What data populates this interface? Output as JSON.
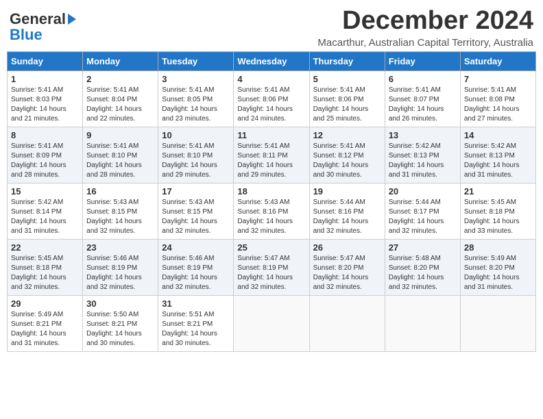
{
  "header": {
    "logo_general": "General",
    "logo_blue": "Blue",
    "month_title": "December 2024",
    "subtitle": "Macarthur, Australian Capital Territory, Australia"
  },
  "days_of_week": [
    "Sunday",
    "Monday",
    "Tuesday",
    "Wednesday",
    "Thursday",
    "Friday",
    "Saturday"
  ],
  "weeks": [
    [
      {
        "day": "1",
        "rise": "5:41 AM",
        "set": "8:03 PM",
        "daylight": "14 hours and 21 minutes"
      },
      {
        "day": "2",
        "rise": "5:41 AM",
        "set": "8:04 PM",
        "daylight": "14 hours and 22 minutes"
      },
      {
        "day": "3",
        "rise": "5:41 AM",
        "set": "8:05 PM",
        "daylight": "14 hours and 23 minutes"
      },
      {
        "day": "4",
        "rise": "5:41 AM",
        "set": "8:06 PM",
        "daylight": "14 hours and 24 minutes"
      },
      {
        "day": "5",
        "rise": "5:41 AM",
        "set": "8:06 PM",
        "daylight": "14 hours and 25 minutes"
      },
      {
        "day": "6",
        "rise": "5:41 AM",
        "set": "8:07 PM",
        "daylight": "14 hours and 26 minutes"
      },
      {
        "day": "7",
        "rise": "5:41 AM",
        "set": "8:08 PM",
        "daylight": "14 hours and 27 minutes"
      }
    ],
    [
      {
        "day": "8",
        "rise": "5:41 AM",
        "set": "8:09 PM",
        "daylight": "14 hours and 28 minutes"
      },
      {
        "day": "9",
        "rise": "5:41 AM",
        "set": "8:10 PM",
        "daylight": "14 hours and 28 minutes"
      },
      {
        "day": "10",
        "rise": "5:41 AM",
        "set": "8:10 PM",
        "daylight": "14 hours and 29 minutes"
      },
      {
        "day": "11",
        "rise": "5:41 AM",
        "set": "8:11 PM",
        "daylight": "14 hours and 29 minutes"
      },
      {
        "day": "12",
        "rise": "5:41 AM",
        "set": "8:12 PM",
        "daylight": "14 hours and 30 minutes"
      },
      {
        "day": "13",
        "rise": "5:42 AM",
        "set": "8:13 PM",
        "daylight": "14 hours and 31 minutes"
      },
      {
        "day": "14",
        "rise": "5:42 AM",
        "set": "8:13 PM",
        "daylight": "14 hours and 31 minutes"
      }
    ],
    [
      {
        "day": "15",
        "rise": "5:42 AM",
        "set": "8:14 PM",
        "daylight": "14 hours and 31 minutes"
      },
      {
        "day": "16",
        "rise": "5:43 AM",
        "set": "8:15 PM",
        "daylight": "14 hours and 32 minutes"
      },
      {
        "day": "17",
        "rise": "5:43 AM",
        "set": "8:15 PM",
        "daylight": "14 hours and 32 minutes"
      },
      {
        "day": "18",
        "rise": "5:43 AM",
        "set": "8:16 PM",
        "daylight": "14 hours and 32 minutes"
      },
      {
        "day": "19",
        "rise": "5:44 AM",
        "set": "8:16 PM",
        "daylight": "14 hours and 32 minutes"
      },
      {
        "day": "20",
        "rise": "5:44 AM",
        "set": "8:17 PM",
        "daylight": "14 hours and 32 minutes"
      },
      {
        "day": "21",
        "rise": "5:45 AM",
        "set": "8:18 PM",
        "daylight": "14 hours and 33 minutes"
      }
    ],
    [
      {
        "day": "22",
        "rise": "5:45 AM",
        "set": "8:18 PM",
        "daylight": "14 hours and 32 minutes"
      },
      {
        "day": "23",
        "rise": "5:46 AM",
        "set": "8:19 PM",
        "daylight": "14 hours and 32 minutes"
      },
      {
        "day": "24",
        "rise": "5:46 AM",
        "set": "8:19 PM",
        "daylight": "14 hours and 32 minutes"
      },
      {
        "day": "25",
        "rise": "5:47 AM",
        "set": "8:19 PM",
        "daylight": "14 hours and 32 minutes"
      },
      {
        "day": "26",
        "rise": "5:47 AM",
        "set": "8:20 PM",
        "daylight": "14 hours and 32 minutes"
      },
      {
        "day": "27",
        "rise": "5:48 AM",
        "set": "8:20 PM",
        "daylight": "14 hours and 32 minutes"
      },
      {
        "day": "28",
        "rise": "5:49 AM",
        "set": "8:20 PM",
        "daylight": "14 hours and 31 minutes"
      }
    ],
    [
      {
        "day": "29",
        "rise": "5:49 AM",
        "set": "8:21 PM",
        "daylight": "14 hours and 31 minutes"
      },
      {
        "day": "30",
        "rise": "5:50 AM",
        "set": "8:21 PM",
        "daylight": "14 hours and 30 minutes"
      },
      {
        "day": "31",
        "rise": "5:51 AM",
        "set": "8:21 PM",
        "daylight": "14 hours and 30 minutes"
      },
      null,
      null,
      null,
      null
    ]
  ]
}
